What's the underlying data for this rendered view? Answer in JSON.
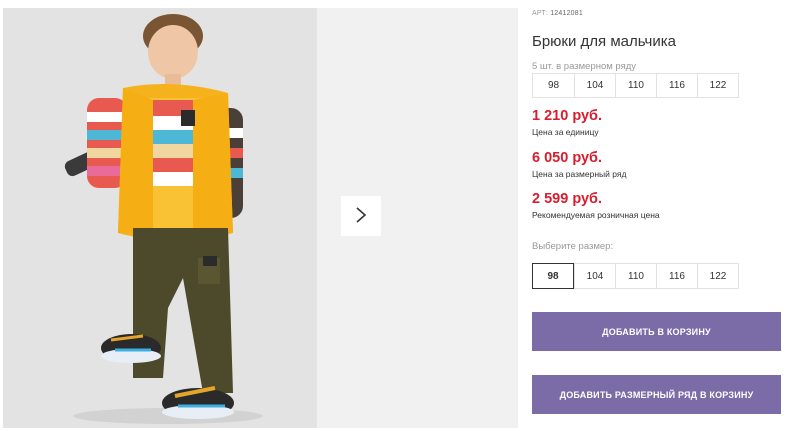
{
  "product": {
    "sku_label": "АРТ:",
    "sku_value": "12412081",
    "title": "Брюки для мальчика"
  },
  "gallery": {
    "image_alt": "photo of boy in yellow vest and olive cargo pants",
    "next_icon": "chevron-right-icon"
  },
  "size_row": {
    "caption": "5 шт. в размерном ряду",
    "sizes": [
      "98",
      "104",
      "110",
      "116",
      "122"
    ]
  },
  "prices": [
    {
      "value": "1 210 руб.",
      "label": "Цена за единицу"
    },
    {
      "value": "6 050 руб.",
      "label": "Цена за размерный ряд"
    },
    {
      "value": "2 599 руб.",
      "label": "Рекомендуемая розничная цена"
    }
  ],
  "size_select": {
    "label": "Выберите размер:",
    "sizes": [
      "98",
      "104",
      "110",
      "116",
      "122"
    ],
    "selected": "98"
  },
  "buttons": {
    "add_to_cart": "Добавить в корзину",
    "add_row_to_cart": "Добавить размерный ряд в корзину"
  },
  "colors": {
    "accent": "#7b6ba7",
    "price": "#d91d2f"
  }
}
